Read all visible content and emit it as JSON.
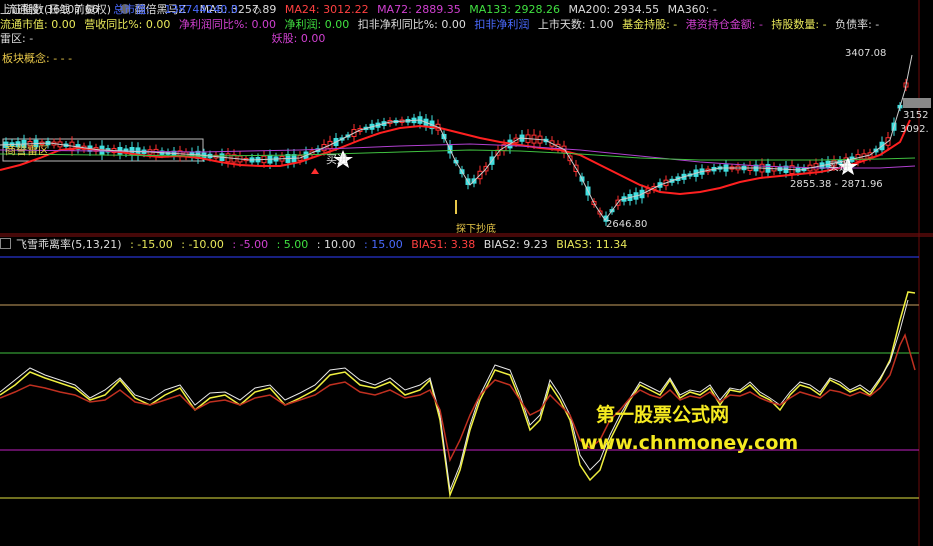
{
  "header": {
    "index_name": "上证指数(日线 前复权)",
    "formula_name": "翻倍黑马Z",
    "ma5": "MA5: 3257.89",
    "ma24": "MA24: 3012.22",
    "ma72": "MA72: 2889.35",
    "ma133": "MA133: 2928.26",
    "ma200": "MA200: 2934.55",
    "ma360": "MA360: -"
  },
  "right_stats": {
    "float_shares": "流通股: 36107.66",
    "market_cap_label": "总市值:",
    "market_cap_value": "138744240.0"
  },
  "row2": {
    "float_value": "流通市值: 0.00",
    "revenue_yoy": "营收同比%: 0.00",
    "profit_yoy": "净利润同比%: 0.00",
    "net_profit": "净利润: 0.00",
    "deduct_yoy": "扣非净利同比%: 0.00",
    "deduct_profit": "扣非净利润",
    "listed_days": "上市天数: 1.00",
    "fund_hold": "基金持股: -",
    "hk_hold": "港资持仓金额: -",
    "hold_count": "持股数量: -",
    "debt_ratio": "负债率: -"
  },
  "row3": {
    "mine": "雷区: -",
    "demon": "妖股: 0.00"
  },
  "concept": "板块概念:   - - -",
  "box_label": "商誉雷区",
  "price_labels": {
    "high": "3407.08",
    "p3152": "3152",
    "p3092": "3092.",
    "mid": "2855.38 - 2871.96",
    "low": "2646.80",
    "bottom_note": "探下抄底",
    "buy1": "买进",
    "buy2": "买进"
  },
  "indicator": {
    "name": "飞雪乖离率(5,13,21)",
    "v1": ": -15.00",
    "v2": ": -10.00",
    "v3": ": -5.00",
    "v4": ": 5.00",
    "v5": ": 10.00",
    "v6": ": 15.00",
    "bias1": "BIAS1: 3.38",
    "bias2": "BIAS2: 9.23",
    "bias3": "BIAS3: 11.34"
  },
  "watermark": {
    "line1": "第一股票公式网",
    "line2": "www.chnmoney.com"
  },
  "colors": {
    "background": "#000000",
    "up": "#ff3030",
    "down": "#40e0e0",
    "ma_red": "#ff2020",
    "ma_purple": "#b040d0",
    "ma_green": "#40c040",
    "bias_yellow": "#f0f040",
    "bias_red": "#c03020",
    "watermark": "#f5ea20"
  }
}
